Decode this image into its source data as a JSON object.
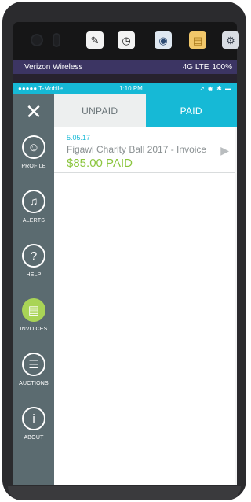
{
  "device": {
    "app_icons": [
      {
        "name": "pen-icon",
        "glyph": "✎"
      },
      {
        "name": "clock-icon",
        "glyph": "◷"
      },
      {
        "name": "camera-icon",
        "glyph": "◉"
      },
      {
        "name": "notes-icon",
        "glyph": "▤"
      },
      {
        "name": "settings-gear-icon",
        "glyph": "⚙"
      }
    ]
  },
  "android_status": {
    "carrier": "Verizon Wireless",
    "network": "4G LTE",
    "battery": "100%"
  },
  "ios_status": {
    "carrier": "●●●●● T-Mobile",
    "time": "1:10 PM",
    "icons": "↗ ◉ ✱ ▬"
  },
  "sidebar": {
    "close_glyph": "✕",
    "items": [
      {
        "label": "PROFILE",
        "icon": "person-icon",
        "glyph": "☺"
      },
      {
        "label": "ALERTS",
        "icon": "bell-icon",
        "glyph": "♫"
      },
      {
        "label": "HELP",
        "icon": "question-icon",
        "glyph": "?"
      },
      {
        "label": "INVOICES",
        "icon": "document-icon",
        "glyph": "▤",
        "active": true
      },
      {
        "label": "AUCTIONS",
        "icon": "list-icon",
        "glyph": "☰"
      },
      {
        "label": "ABOUT",
        "icon": "info-icon",
        "glyph": "i"
      }
    ]
  },
  "tabs": {
    "unpaid": "UNPAID",
    "paid": "PAID",
    "selected": "PAID"
  },
  "invoices": [
    {
      "date": "5.05.17",
      "title": "Figawi Charity Ball 2017 - Invoice",
      "amount": "$85.00 PAID"
    }
  ],
  "colors": {
    "accent": "#16b9d6",
    "paid_green": "#8cc63f",
    "active_nav": "#a9d456",
    "sidebar": "#5b6b70"
  }
}
